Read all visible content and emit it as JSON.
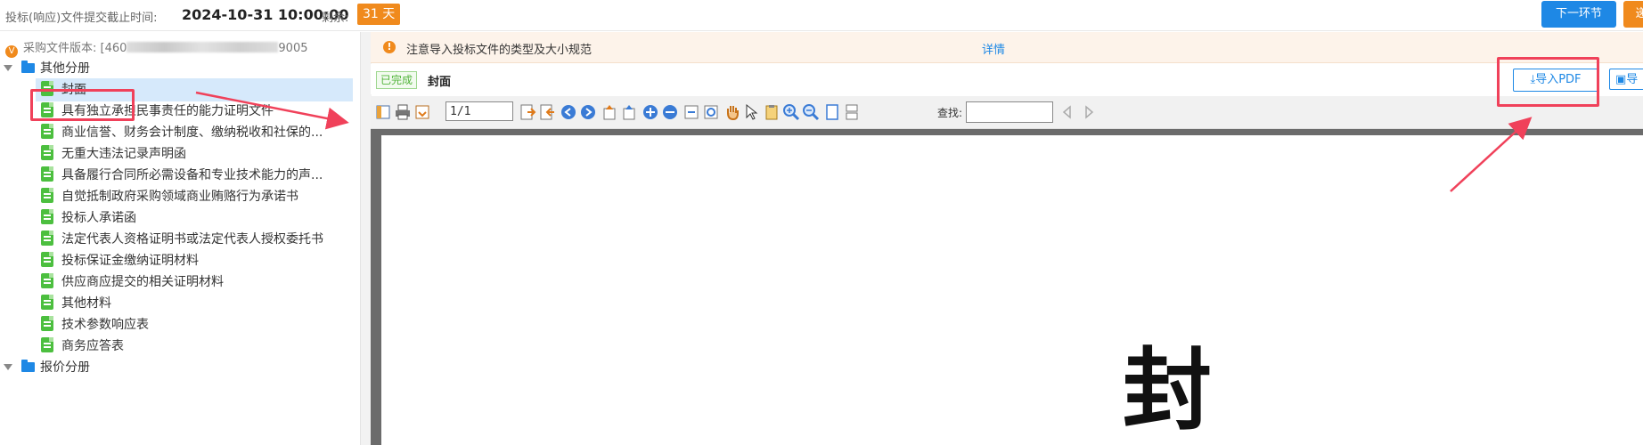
{
  "topbar": {
    "deadline_label": "投标(响应)文件提交截止时间:",
    "deadline_value": "2024-10-31 10:00:00",
    "remaining_label": "剩余:",
    "remaining_value": "31 天",
    "next_step_button": "下一环节",
    "orange_button": "递"
  },
  "sidebar": {
    "version_prefix": "采购文件版本: [460",
    "version_suffix": "9005",
    "groups": [
      {
        "label": "其他分册",
        "items": [
          {
            "label": "封面",
            "selected": true
          },
          {
            "label": "具有独立承担民事责任的能力证明文件"
          },
          {
            "label": "商业信誉、财务会计制度、缴纳税收和社保的..."
          },
          {
            "label": "无重大违法记录声明函"
          },
          {
            "label": "具备履行合同所必需设备和专业技术能力的声..."
          },
          {
            "label": "自觉抵制政府采购领域商业贿赂行为承诺书"
          },
          {
            "label": "投标人承诺函"
          },
          {
            "label": "法定代表人资格证明书或法定代表人授权委托书"
          },
          {
            "label": "投标保证金缴纳证明材料"
          },
          {
            "label": "供应商应提交的相关证明材料"
          },
          {
            "label": "其他材料"
          },
          {
            "label": "技术参数响应表"
          },
          {
            "label": "商务应答表"
          }
        ]
      },
      {
        "label": "报价分册",
        "items": []
      }
    ]
  },
  "notice": {
    "text": "注意导入投标文件的类型及大小规范",
    "link": "详情"
  },
  "section": {
    "status": "已完成",
    "title": "封面",
    "import_pdf_button": "导入PDF",
    "import_other_button": "导"
  },
  "pdf_toolbar": {
    "page_value": "1/1",
    "find_label": "查找:",
    "icons": [
      "sidebar-toggle-icon",
      "print-icon",
      "save-icon",
      "next-page-icon",
      "prev-page-icon",
      "back-icon",
      "forward-icon",
      "first-page-icon",
      "last-page-icon",
      "zoom-in-icon",
      "zoom-out-icon",
      "fit-width-icon",
      "fit-page-icon",
      "hand-tool-icon",
      "select-tool-icon",
      "clipboard-icon",
      "magnify-plus-icon",
      "magnify-minus-icon",
      "single-page-icon",
      "continuous-page-icon",
      "find-prev-icon",
      "find-next-icon"
    ]
  },
  "document": {
    "visible_text": "封"
  },
  "colors": {
    "accent": "#1e88e5",
    "warning": "#f08a1d",
    "success": "#4cbf3f",
    "annotation": "#f0415a"
  }
}
